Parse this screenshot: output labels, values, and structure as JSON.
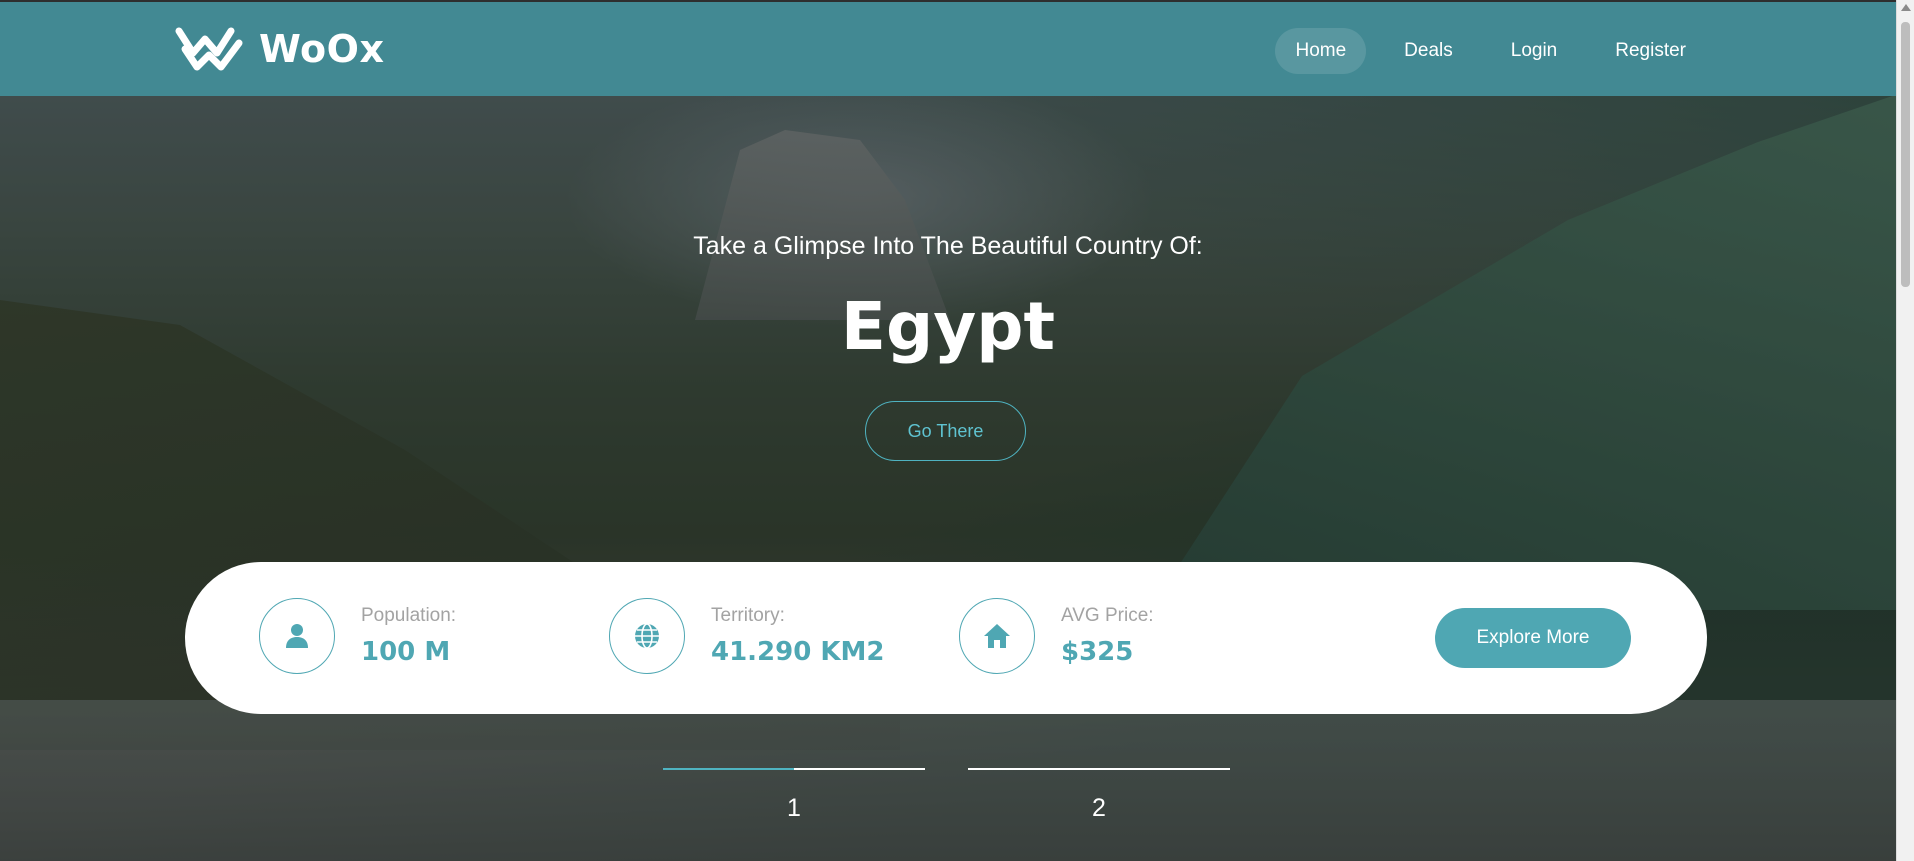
{
  "header": {
    "logo_text": "WoOx",
    "nav": [
      {
        "label": "Home",
        "active": true
      },
      {
        "label": "Deals",
        "active": false
      },
      {
        "label": "Login",
        "active": false
      },
      {
        "label": "Register",
        "active": false
      }
    ]
  },
  "hero": {
    "tagline": "Take a Glimpse Into The Beautiful Country Of:",
    "country": "Egypt",
    "cta_label": "Go There"
  },
  "info": {
    "stats": [
      {
        "label": "Population:",
        "value": "100 M",
        "icon": "user-icon"
      },
      {
        "label": "Territory:",
        "value": "41.290 KM2",
        "icon": "globe-icon"
      },
      {
        "label": "AVG Price:",
        "value": "$325",
        "icon": "home-icon"
      }
    ],
    "explore_label": "Explore More"
  },
  "slider": {
    "slides": [
      {
        "number": "1",
        "progress": 0.5
      },
      {
        "number": "2",
        "progress": 0
      }
    ]
  },
  "colors": {
    "header_bg": "#428993",
    "accent": "#4fa7b3",
    "accent_light": "#5fc3d1"
  }
}
